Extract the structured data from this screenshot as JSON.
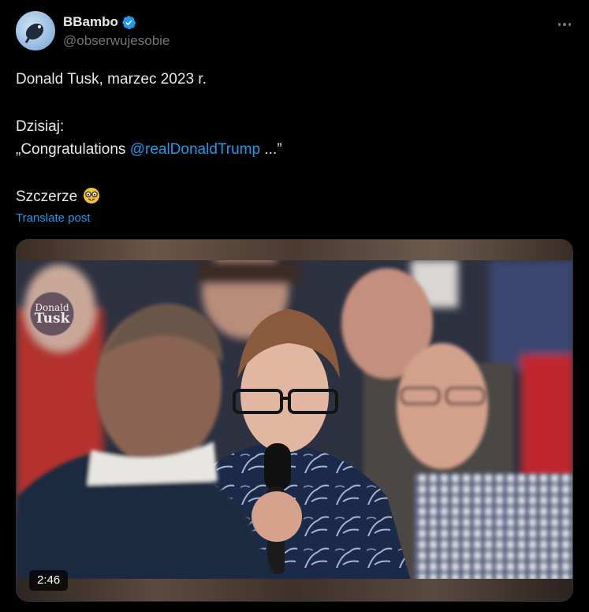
{
  "author": {
    "display_name": "BBambo",
    "handle": "@obserwujesobie",
    "verified": true,
    "avatar_icon": "avatar-satellite-dish-icon"
  },
  "menu": {
    "icon": "more-horizontal-icon"
  },
  "post": {
    "line1": "Donald Tusk, marzec 2023 r.",
    "line2": "Dzisiaj:",
    "line3_prefix": "„Congratulations ",
    "line3_mention": "@realDonaldTrump",
    "line3_suffix": " ...”",
    "line4": "Szczerze",
    "emoji": "nerd-face-emoji"
  },
  "translate_label": "Translate post",
  "media": {
    "watermark_line1": "Donald",
    "watermark_line2": "Tusk",
    "duration": "2:46"
  },
  "colors": {
    "background": "#000000",
    "text": "#e7e9ea",
    "muted": "#71767b",
    "accent": "#1d9bf0"
  }
}
